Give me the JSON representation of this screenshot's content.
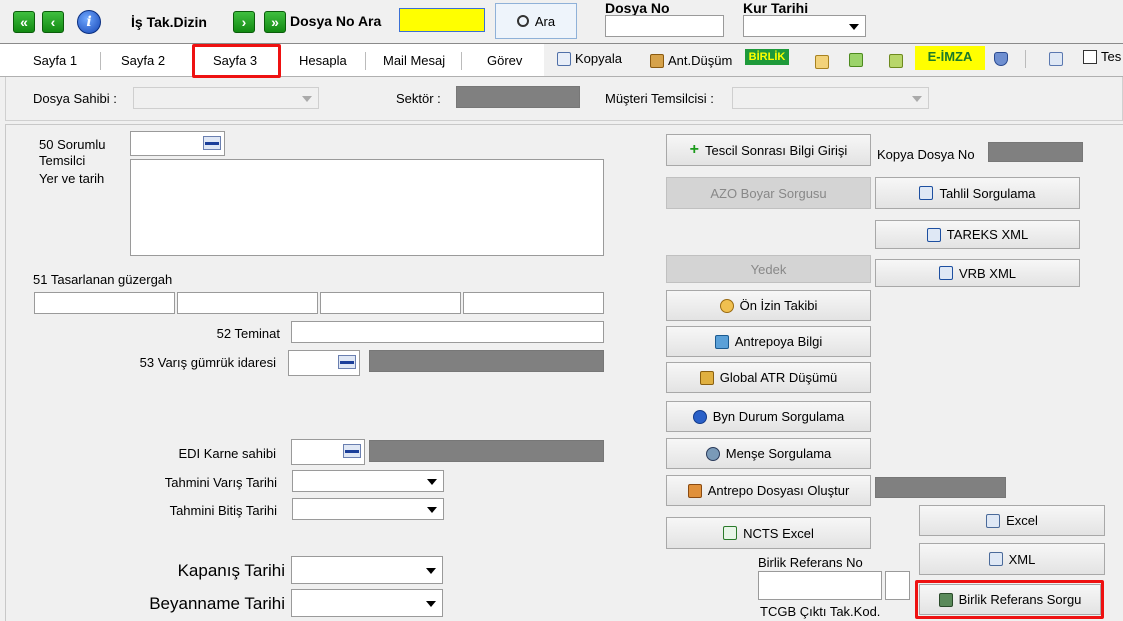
{
  "toolbar": {
    "first_icon": "double-chevron-left-icon",
    "prev_icon": "chevron-left-icon",
    "info_icon": "info-icon",
    "is_tak_dizin": "İş Tak.Dizin",
    "next_icon": "chevron-right-icon",
    "last_icon": "double-chevron-right-icon",
    "dosya_no_ara_label": "Dosya No Ara",
    "dosya_no_ara_value": "",
    "ara_button": "Ara",
    "dosya_no_label": "Dosya No",
    "dosya_no_value": "",
    "kur_tarihi_label": "Kur Tarihi",
    "kur_tarihi_value": ""
  },
  "tabs": [
    {
      "label": "Sayfa 1"
    },
    {
      "label": "Sayfa 2"
    },
    {
      "label": "Sayfa 3"
    },
    {
      "label": "Hesapla"
    },
    {
      "label": "Mail Mesaj"
    },
    {
      "label": "Görev"
    }
  ],
  "toolstrip": {
    "kopyala": "Kopyala",
    "ant_dusum": "Ant.Düşüm",
    "birlik": "BİRLİK",
    "e_imza": "E-İMZA",
    "test_checkbox": "Tes"
  },
  "header_fields": {
    "dosya_sahibi_label": "Dosya Sahibi :",
    "dosya_sahibi_value": "",
    "sektor_label": "Sektör :",
    "musteri_temsilcisi_label": "Müşteri Temsilcisi :",
    "musteri_temsilcisi_value": ""
  },
  "left": {
    "sorumlu_label_1": "50 Sorumlu",
    "sorumlu_label_2": "Temsilci",
    "yer_tarih_label": "Yer ve tarih",
    "tasarlanan_label": "51 Tasarlanan güzergah",
    "teminat_label": "52 Teminat",
    "varis_label": "53 Varış gümrük idaresi",
    "edi_karne_label": "EDI Karne sahibi",
    "tahmini_varis_label": "Tahmini Varış Tarihi",
    "tahmini_bitis_label": "Tahmini Bitiş Tarihi",
    "kapanis_label": "Kapanış Tarihi",
    "beyanname_label": "Beyanname Tarihi"
  },
  "right": {
    "tescil_sonrasi": "Tescil Sonrası Bilgi Girişi",
    "kopya_dosya_no_label": "Kopya Dosya No",
    "azo_boyar": "AZO Boyar Sorgusu",
    "tahlil_sorgulama": "Tahlil Sorgulama",
    "tareks_xml": "TAREKS XML",
    "yedek": "Yedek",
    "vrb_xml": "VRB XML",
    "on_izin": "Ön İzin Takibi",
    "antrepoya_bilgi": "Antrepoya Bilgi",
    "global_atr": "Global ATR Düşümü",
    "byn_durum": "Byn Durum Sorgulama",
    "mense": "Menşe Sorgulama",
    "antrepo_dosyasi": "Antrepo Dosyası Oluştur",
    "excel": "Excel",
    "ncts_excel": "NCTS Excel",
    "xml": "XML",
    "birlik_referans_no_label": "Birlik Referans No",
    "birlik_referans_sorgu": "Birlik Referans Sorgu",
    "tcgb_label": "TCGB Çıktı Tak.Kod."
  },
  "colors": {
    "highlight_red": "#e11111",
    "search_yellow": "#ffff00",
    "e_imza_yellow": "#ffff00",
    "birlik_green": "#1e9a3a"
  }
}
